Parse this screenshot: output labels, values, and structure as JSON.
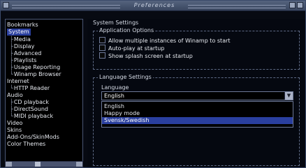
{
  "window": {
    "title": "Preferences"
  },
  "sidebar": {
    "items": [
      {
        "label": "Bookmarks",
        "level": 0,
        "selected": false
      },
      {
        "label": "System",
        "level": 0,
        "selected": true
      },
      {
        "label": "Media",
        "level": 1,
        "selected": false
      },
      {
        "label": "Display",
        "level": 1,
        "selected": false
      },
      {
        "label": "Advanced",
        "level": 1,
        "selected": false
      },
      {
        "label": "Playlists",
        "level": 1,
        "selected": false
      },
      {
        "label": "Usage Reporting",
        "level": 1,
        "selected": false
      },
      {
        "label": "Winamp Browser",
        "level": 1,
        "selected": false
      },
      {
        "label": "Internet",
        "level": 0,
        "selected": false
      },
      {
        "label": "HTTP Reader",
        "level": 1,
        "selected": false
      },
      {
        "label": "Audio",
        "level": 0,
        "selected": false
      },
      {
        "label": "CD playback",
        "level": 1,
        "selected": false
      },
      {
        "label": "DirectSound",
        "level": 1,
        "selected": false
      },
      {
        "label": "MIDI playback",
        "level": 1,
        "selected": false
      },
      {
        "label": "Video",
        "level": 0,
        "selected": false
      },
      {
        "label": "Skins",
        "level": 0,
        "selected": false
      },
      {
        "label": "Add-Ons/SkinMods",
        "level": 0,
        "selected": false
      },
      {
        "label": "Color Themes",
        "level": 0,
        "selected": false
      }
    ]
  },
  "panel": {
    "title": "System Settings",
    "app_options": {
      "legend": "Application Options",
      "options": [
        {
          "label": "Allow multiple instances of Winamp to start",
          "checked": false
        },
        {
          "label": "Auto-play at startup",
          "checked": false
        },
        {
          "label": "Show splash screen at startup",
          "checked": false
        }
      ]
    },
    "language": {
      "legend": "Language Settings",
      "label": "Language",
      "selected": "English",
      "options": [
        "English",
        "Happy mode",
        "Svensk/Swedish"
      ],
      "highlighted": "Svensk/Swedish"
    }
  }
}
